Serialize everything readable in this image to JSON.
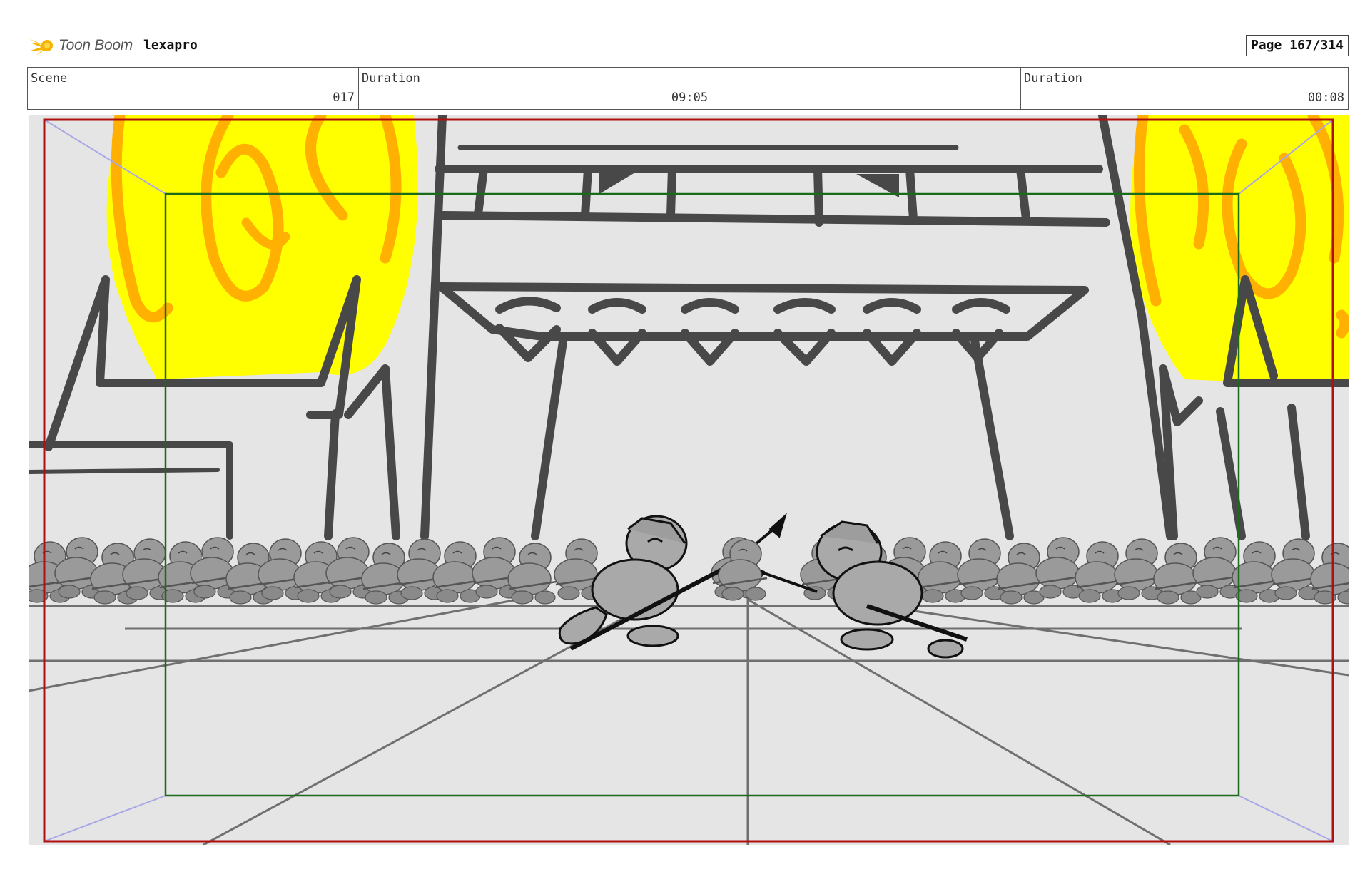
{
  "header": {
    "brand": "Toon Boom",
    "project": "lexapro",
    "page_label": "Page 167/314"
  },
  "info": {
    "scene_label": "Scene",
    "scene_value": "017",
    "duration1_label": "Duration",
    "duration1_value": "09:05",
    "duration2_label": "Duration",
    "duration2_value": "00:08"
  },
  "colors": {
    "flame_yellow": "#ffff00",
    "flame_orange": "#ffb000",
    "safe_frame_red": "#b01010",
    "title_safe_green": "#1a6b1a",
    "guide_lavender": "#a7a7e6",
    "background": "#e5e5e5",
    "structure": "#484848"
  },
  "icons": {
    "logo": "toon-boom-comet-icon"
  }
}
